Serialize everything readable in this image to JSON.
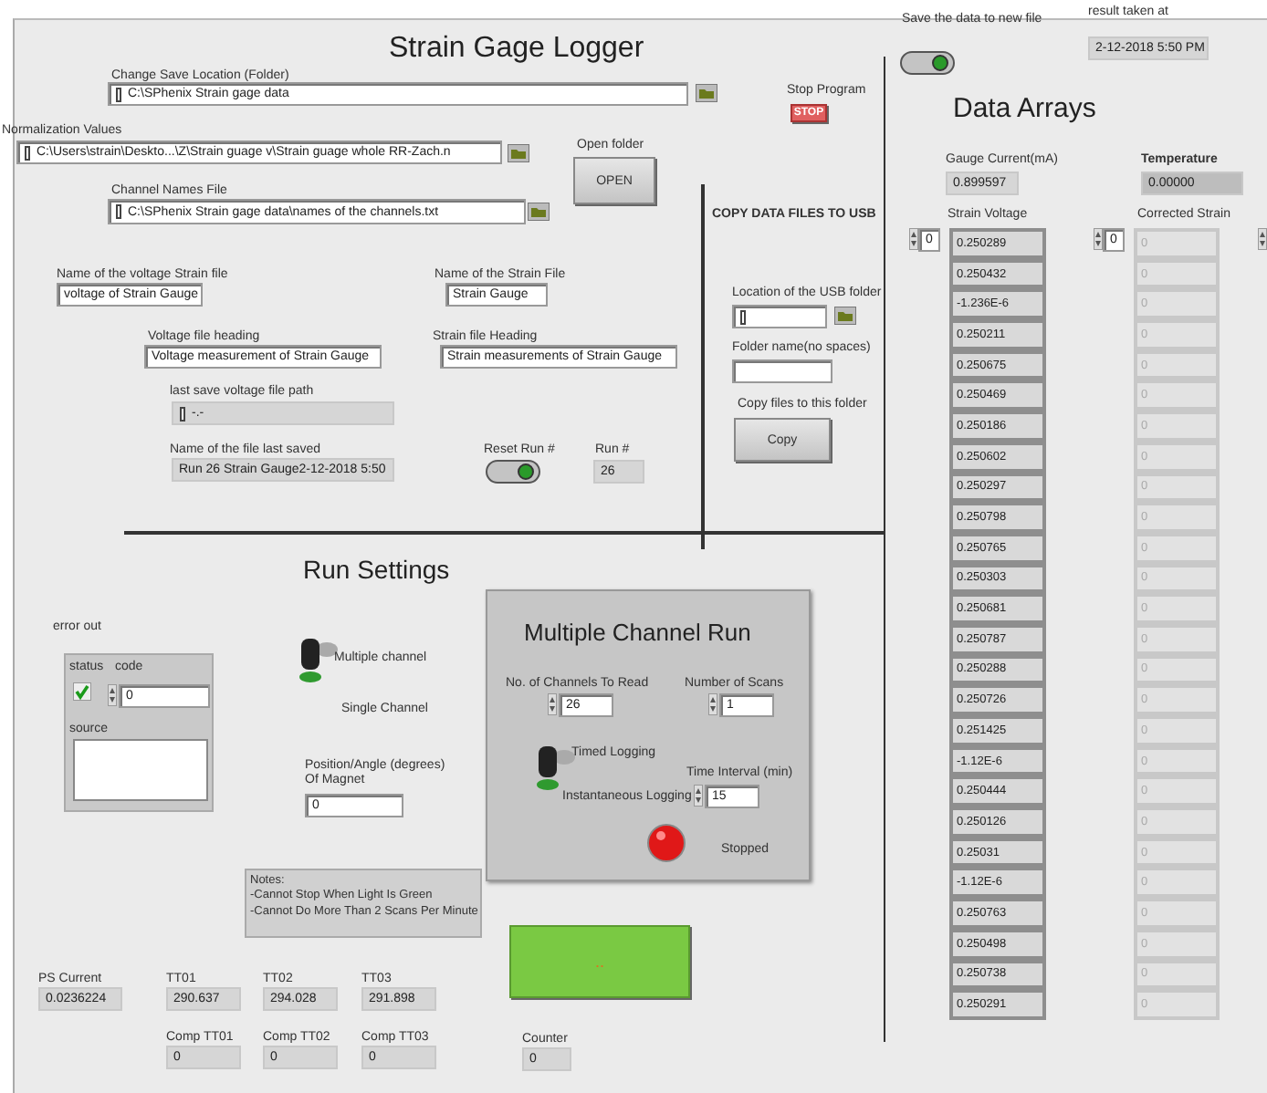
{
  "title": "Strain Gage Logger",
  "save_location": {
    "label": "Change Save Location (Folder)",
    "value": "C:\\SPhenix Strain gage data"
  },
  "stop": {
    "label": "Stop Program",
    "button": "STOP"
  },
  "normalization": {
    "label": "Normalization Values",
    "value": "C:\\Users\\strain\\Deskto...\\Z\\Strain guage v\\Strain guage whole RR-Zach.n"
  },
  "open_folder": {
    "label": "Open folder",
    "button": "OPEN"
  },
  "channel_names": {
    "label": "Channel Names File",
    "value": "C:\\SPhenix Strain gage data\\names of the channels.txt"
  },
  "copy_usb": {
    "heading": "COPY DATA FILES TO USB",
    "location_label": "Location of the USB folder",
    "folder_label": "Folder name(no spaces)",
    "copy_label": "Copy files to this folder",
    "copy_button": "Copy"
  },
  "voltage_file_name": {
    "label": "Name of the voltage Strain file",
    "value": "voltage of Strain Gauge"
  },
  "strain_file_name": {
    "label": "Name of the Strain File",
    "value": "Strain Gauge"
  },
  "voltage_heading": {
    "label": "Voltage file heading",
    "value": "Voltage measurement of Strain Gauge"
  },
  "strain_heading": {
    "label": "Strain file Heading",
    "value": "Strain measurements of Strain Gauge"
  },
  "last_path": {
    "label": "last save voltage file path",
    "value": "-.-"
  },
  "last_file": {
    "label": "Name of the file last saved",
    "value": "Run 26 Strain Gauge2-12-2018 5:50"
  },
  "reset_run": {
    "label": "Reset Run #",
    "on": true
  },
  "run_number": {
    "label": "Run #",
    "value": "26"
  },
  "save_new_file": {
    "label": "Save the data to new file",
    "on": true
  },
  "result_time": {
    "label": "result taken at",
    "value": "2-12-2018 5:50 PM"
  },
  "data_arrays": {
    "title": "Data Arrays",
    "gauge_label": "Gauge Current(mA)",
    "gauge_value": "0.899597",
    "temp_label": "Temperature",
    "temp_value": "0.00000",
    "voltage_label": "Strain Voltage",
    "voltage_index": "0",
    "corrected_label": "Corrected Strain",
    "corrected_index": "0",
    "voltage": [
      "0.250289",
      "0.250432",
      "-1.236E-6",
      "0.250211",
      "0.250675",
      "0.250469",
      "0.250186",
      "0.250602",
      "0.250297",
      "0.250798",
      "0.250765",
      "0.250303",
      "0.250681",
      "0.250787",
      "0.250288",
      "0.250726",
      "0.251425",
      "-1.12E-6",
      "0.250444",
      "0.250126",
      "0.25031",
      "-1.12E-6",
      "0.250763",
      "0.250498",
      "0.250738",
      "0.250291"
    ],
    "corrected": [
      "0",
      "0",
      "0",
      "0",
      "0",
      "0",
      "0",
      "0",
      "0",
      "0",
      "0",
      "0",
      "0",
      "0",
      "0",
      "0",
      "0",
      "0",
      "0",
      "0",
      "0",
      "0",
      "0",
      "0",
      "0",
      "0"
    ]
  },
  "run_settings": {
    "title": "Run Settings"
  },
  "error_out": {
    "label": "error out",
    "status_label": "status",
    "status_ok": true,
    "code_label": "code",
    "code": "0",
    "source_label": "source"
  },
  "channel_switch": {
    "top_label": "Multiple channel",
    "bottom_label": "Single Channel",
    "up": true
  },
  "magnet": {
    "label": "Position/Angle (degrees)\nOf Magnet",
    "value": "0"
  },
  "notes": [
    "Notes:",
    "-Cannot Stop When Light Is Green",
    "-Cannot Do More Than 2 Scans Per Minute"
  ],
  "multi_run": {
    "title": "Multiple Channel Run",
    "channels_label": "No. of Channels To Read",
    "channels": "26",
    "scans_label": "Number of Scans",
    "scans": "1",
    "top_label": "Timed Logging",
    "bottom_label": "Instantaneous Logging",
    "up": true,
    "interval_label": "Time Interval (min)",
    "interval": "15",
    "led_label": "Stopped",
    "led_lit": true
  },
  "green_button": {
    "label": ".."
  },
  "readouts": [
    {
      "label": "PS Current",
      "value": "0.0236224"
    },
    {
      "label": "TT01",
      "value": "290.637"
    },
    {
      "label": "TT02",
      "value": "294.028"
    },
    {
      "label": "TT03",
      "value": "291.898"
    },
    {
      "label": "Comp TT01",
      "value": "0"
    },
    {
      "label": "Comp TT02",
      "value": "0"
    },
    {
      "label": "Comp TT03",
      "value": "0"
    },
    {
      "label": "Counter",
      "value": "0"
    }
  ]
}
